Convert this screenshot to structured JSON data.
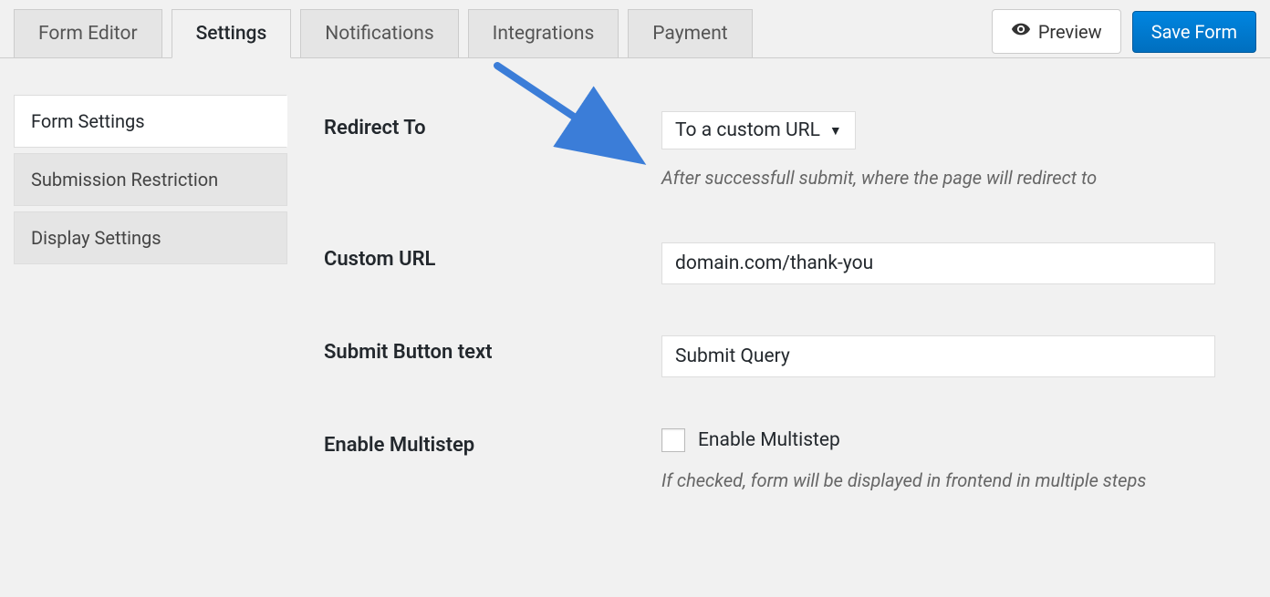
{
  "tabs": {
    "form_editor": "Form Editor",
    "settings": "Settings",
    "notifications": "Notifications",
    "integrations": "Integrations",
    "payment": "Payment"
  },
  "actions": {
    "preview": "Preview",
    "save": "Save Form"
  },
  "sidebar": {
    "form_settings": "Form Settings",
    "submission_restriction": "Submission Restriction",
    "display_settings": "Display Settings"
  },
  "fields": {
    "redirect": {
      "label": "Redirect To",
      "value": "To a custom URL",
      "help": "After successfull submit, where the page will redirect to"
    },
    "custom_url": {
      "label": "Custom URL",
      "value": "domain.com/thank-you"
    },
    "submit_text": {
      "label": "Submit Button text",
      "value": "Submit Query"
    },
    "multistep": {
      "label": "Enable Multistep",
      "checkbox_label": "Enable Multistep",
      "help": "If checked, form will be displayed in frontend in multiple steps"
    }
  }
}
